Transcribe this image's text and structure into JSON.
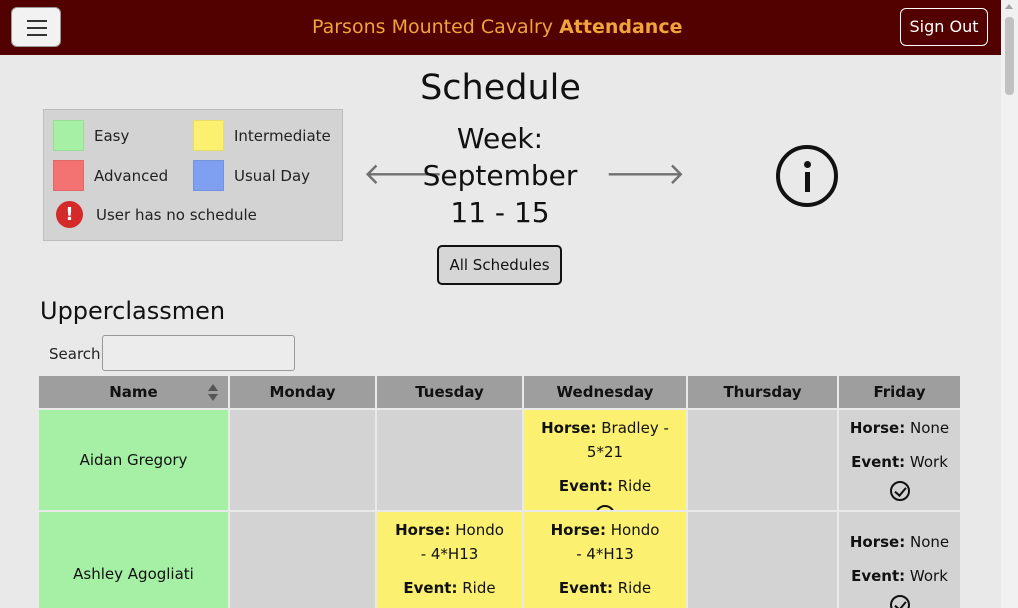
{
  "navbar": {
    "brand_prefix": "Parsons Mounted Cavalry",
    "brand_bold": "Attendance",
    "sign_out": "Sign Out"
  },
  "page": {
    "title": "Schedule",
    "week_line1": "Week:",
    "week_line2": "September",
    "week_line3": "11 - 15",
    "prev_arrow": "🡐",
    "next_arrow": "🡒",
    "all_schedules": "All Schedules"
  },
  "legend": {
    "easy": "Easy",
    "intermediate": "Intermediate",
    "advanced": "Advanced",
    "usual_day": "Usual Day",
    "no_schedule": "User has no schedule",
    "warn_glyph": "!",
    "colors": {
      "easy": "#a6f0a6",
      "intermediate": "#fbf070",
      "advanced": "#f37272",
      "usual_day": "#7f9ff0"
    }
  },
  "section": {
    "title": "Upperclassmen",
    "search_label": "Search:",
    "search_value": ""
  },
  "table": {
    "headers": [
      "Name",
      "Monday",
      "Tuesday",
      "Wednesday",
      "Thursday",
      "Friday"
    ],
    "rows": [
      {
        "name": "Aidan Gregory",
        "wed_horse_label": "Horse:",
        "wed_horse": "Bradley - 5*21",
        "wed_event_label": "Event:",
        "wed_event": "Ride",
        "fri_horse_label": "Horse:",
        "fri_horse": "None",
        "fri_event_label": "Event:",
        "fri_event": "Work"
      },
      {
        "name": "Ashley Agogliati",
        "tue_horse_label": "Horse:",
        "tue_horse": "Hondo - 4*H13",
        "tue_event_label": "Event:",
        "tue_event": "Ride",
        "wed_horse_label": "Horse:",
        "wed_horse": "Hondo - 4*H13",
        "wed_event_label": "Event:",
        "wed_event": "Ride",
        "fri_horse_label": "Horse:",
        "fri_horse": "None",
        "fri_event_label": "Event:",
        "fri_event": "Work"
      }
    ]
  }
}
